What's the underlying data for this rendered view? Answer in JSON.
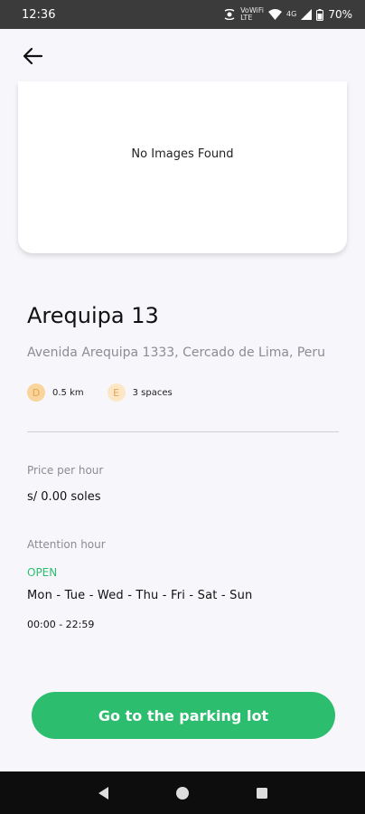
{
  "status_bar": {
    "time": "12:36",
    "network_small_top": "VoWiFi",
    "network_small_bottom": "LTE",
    "network_label": "4G",
    "battery": "70%",
    "icons": [
      "screen-mirror-icon",
      "wifi-icon",
      "signal-icon",
      "battery-icon"
    ]
  },
  "header": {
    "back_icon": "back-arrow-icon"
  },
  "image_card": {
    "placeholder": "No Images Found"
  },
  "parking": {
    "name": "Arequipa 13",
    "address": "Avenida Arequipa 1333, Cercado de Lima, Peru",
    "distance": {
      "icon_letter": "D",
      "text": "0.5 km"
    },
    "spaces": {
      "icon_letter": "E",
      "text": "3 spaces"
    }
  },
  "price": {
    "label": "Price per hour",
    "value": "s/ 0.00 soles"
  },
  "attention": {
    "label": "Attention hour",
    "status": "OPEN",
    "days": "Mon - Tue - Wed - Thu - Fri - Sat - Sun",
    "hours": "00:00 - 22:59"
  },
  "cta": {
    "label": "Go to the parking lot"
  },
  "colors": {
    "accent": "#2dbd6e",
    "status_bar": "#3b3b3b",
    "nav_bar": "#0d0d0d",
    "chip_d": "#f9d49c",
    "chip_e": "#fde6c4"
  },
  "nav_bar": {
    "buttons": [
      "back-triangle-icon",
      "home-circle-icon",
      "recents-square-icon"
    ]
  }
}
